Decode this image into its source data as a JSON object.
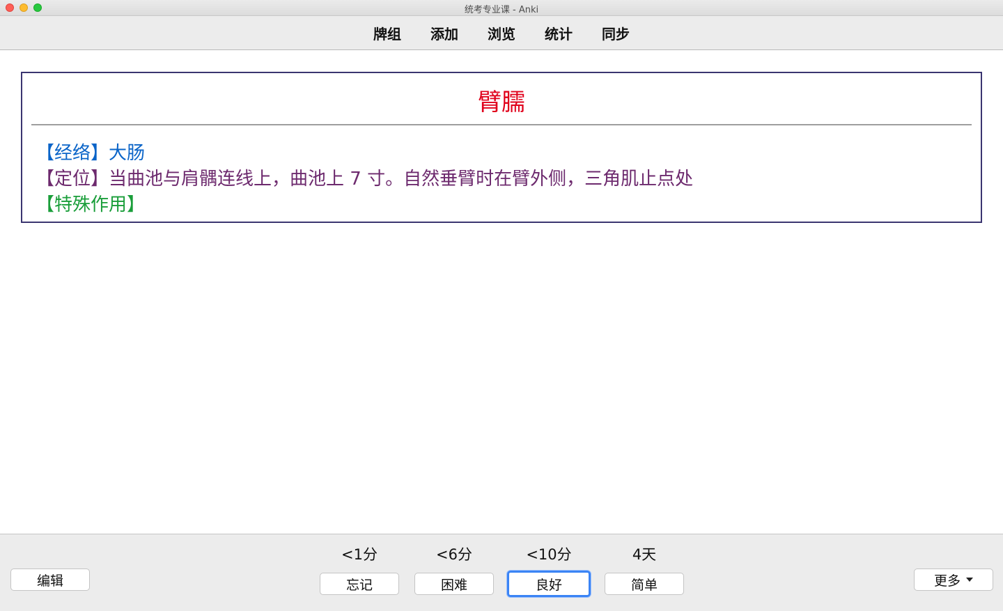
{
  "window": {
    "title": "统考专业课 - Anki"
  },
  "toolbar": {
    "items": [
      "牌组",
      "添加",
      "浏览",
      "统计",
      "同步"
    ]
  },
  "card": {
    "front": "臂臑",
    "meridian": "【经络】大肠",
    "location": "【定位】当曲池与肩髃连线上，曲池上 7 寸。自然垂臂时在臂外侧，三角肌止点处",
    "special": "【特殊作用】"
  },
  "bottom": {
    "edit_label": "编辑",
    "more_label": "更多",
    "answers": [
      {
        "time": "<1分",
        "label": "忘记"
      },
      {
        "time": "<6分",
        "label": "困难"
      },
      {
        "time": "<10分",
        "label": "良好"
      },
      {
        "time": "4天",
        "label": "简单"
      }
    ]
  },
  "colors": {
    "front": "#e0001b",
    "meridian": "#0a64c8",
    "location": "#6d2a6e",
    "special": "#1a9e3a",
    "card_border": "#3a3570",
    "focus_ring": "#3b84f5"
  }
}
